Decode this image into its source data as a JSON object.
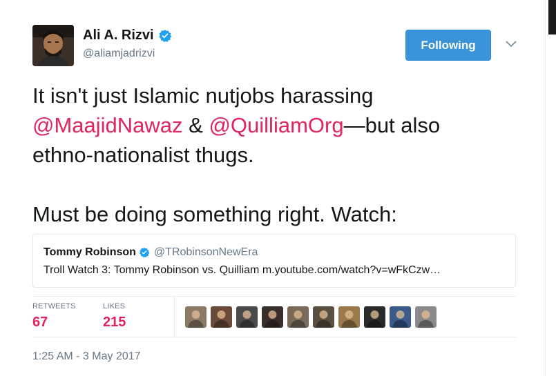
{
  "author": {
    "display_name": "Ali A. Rizvi",
    "handle": "@aliamjadrizvi",
    "verified": true,
    "avatar": "profile-photo"
  },
  "follow_button": {
    "label": "Following",
    "color": "#3b94d9"
  },
  "menu": {
    "icon": "chevron-down-icon"
  },
  "tweet": {
    "line1": "It isn't just Islamic nutjobs harassing",
    "mention1": "@MaajidNawaz",
    "amp": " & ",
    "mention2": "@QuilliamOrg",
    "line2_tail": "—but also",
    "line3": "ethno-nationalist thugs.",
    "line4": "Must be doing something right. Watch:"
  },
  "quoted_tweet": {
    "name": "Tommy Robinson",
    "verified": true,
    "handle": "@TRobinsonNewEra",
    "text": "Troll Watch 3: Tommy Robinson vs. Quilliam  m.youtube.com/watch?v=wFkCzw…"
  },
  "stats": {
    "retweets_label": "RETWEETS",
    "retweets_count": "67",
    "likes_label": "LIKES",
    "likes_count": "215"
  },
  "likers": [
    {
      "avatar": "user-avatar-1",
      "color": "#8a7a66"
    },
    {
      "avatar": "user-avatar-2",
      "color": "#6b4a3a"
    },
    {
      "avatar": "user-avatar-3",
      "color": "#4a4a4a"
    },
    {
      "avatar": "user-avatar-4",
      "color": "#3a2e2a"
    },
    {
      "avatar": "user-avatar-5",
      "color": "#7a6a5a"
    },
    {
      "avatar": "user-avatar-6",
      "color": "#5a5040"
    },
    {
      "avatar": "user-avatar-7",
      "color": "#9a7a4a"
    },
    {
      "avatar": "user-avatar-8",
      "color": "#2a2a2a"
    },
    {
      "avatar": "user-avatar-9",
      "color": "#3a5a8a"
    },
    {
      "avatar": "user-avatar-10",
      "color": "#8a8a8a"
    }
  ],
  "timestamp": "1:25 AM - 3 May 2017",
  "colors": {
    "mention": "#e0245e",
    "secondary_text": "#657786",
    "verified": "#1da1f2"
  }
}
